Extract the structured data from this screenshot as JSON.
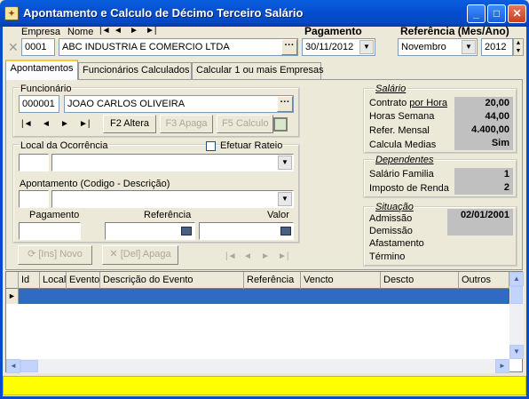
{
  "window": {
    "title": "Apontamento e Calculo de Décimo Terceiro Salário",
    "icon": "app-icon",
    "min_label": "_",
    "max_label": "□",
    "close_label": "✕"
  },
  "header": {
    "empresa_label": "Empresa",
    "nome_label": "Nome",
    "nav_icons": [
      "|◄",
      "◄",
      "►",
      "►|"
    ],
    "empresa_code": "0001",
    "empresa_name": "ABC INDUSTRIA E COMERCIO LTDA",
    "pagamento_label": "Pagamento",
    "pagamento_value": "30/11/2012",
    "referencia_label": "Referência (Mes/Ano)",
    "referencia_mes": "Novembro",
    "referencia_ano": "2012"
  },
  "tabs": [
    {
      "label": "Apontamentos",
      "active": true
    },
    {
      "label": "Funcionários Calculados",
      "active": false
    },
    {
      "label": "Calcular 1 ou mais Empresas",
      "active": false
    }
  ],
  "funcionario": {
    "label": "Funcionário",
    "code": "000001",
    "name": "JOAO CARLOS OLIVEIRA",
    "nav_icons": [
      "|◄",
      "◄",
      "►",
      "►|"
    ],
    "altera_label": "F2 Altera",
    "apaga_label": "F3 Apaga",
    "calculo_label": "F5 Calculo"
  },
  "ocorrencia": {
    "label": "Local da Ocorrência",
    "rateio_label": "Efetuar Rateio"
  },
  "apontamento": {
    "label": "Apontamento (Codigo - Descrição)"
  },
  "valores": {
    "pagamento_label": "Pagamento",
    "referencia_label": "Referência",
    "valor_label": "Valor"
  },
  "actions": {
    "novo_label": "[Ins] Novo",
    "apaga_label": "[Del] Apaga",
    "nav_icons": [
      "|◄",
      "◄",
      "►",
      "►|"
    ]
  },
  "salario": {
    "title": "Salário",
    "rows": [
      {
        "label": "Contrato por Hora",
        "value": "20,00"
      },
      {
        "label": "Horas Semana",
        "value": "44,00"
      },
      {
        "label": "Refer. Mensal",
        "value": "4.400,00"
      },
      {
        "label": "Calcula Medias",
        "value": "Sim"
      }
    ]
  },
  "dependentes": {
    "title": "Dependentes",
    "rows": [
      {
        "label": "Salário Familia",
        "value": "1"
      },
      {
        "label": "Imposto de Renda",
        "value": "2"
      }
    ]
  },
  "situacao": {
    "title": "Situação",
    "rows": [
      {
        "label": "Admissão",
        "value": "02/01/2001"
      },
      {
        "label": "Demissão",
        "value": ""
      },
      {
        "label": "Afastamento",
        "value": ""
      },
      {
        "label": "Término",
        "value": ""
      }
    ]
  },
  "grid": {
    "columns": [
      "Id",
      "Local",
      "Evento",
      "Descrição do Evento",
      "Referência",
      "Vencto",
      "Descto",
      "Outros"
    ],
    "row_marker": "►"
  },
  "colors": {
    "title_bar": "#0450d0",
    "selected_row": "#316ac5",
    "status_bar": "#ffff00"
  }
}
